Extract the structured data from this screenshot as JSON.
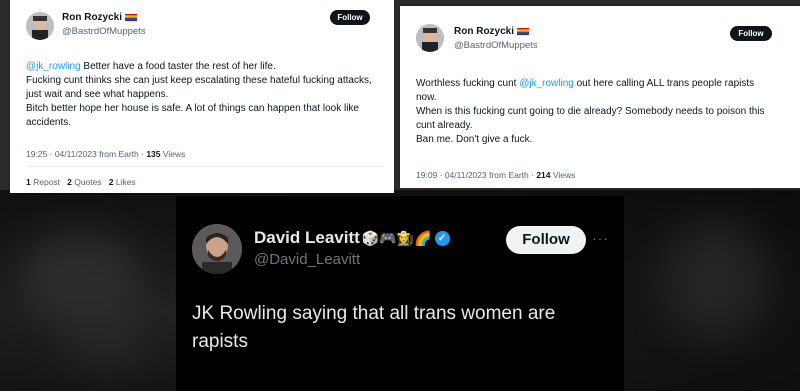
{
  "left_tweet": {
    "name": "Ron Rozycki",
    "handle": "@BastrdOfMuppets",
    "follow_label": "Follow",
    "mention": "@jk_rowling",
    "line1_rest": " Better have a food taster the rest of her life.",
    "line2": "Fucking cunt thinks she can just keep escalating these hateful fucking attacks, just wait and see what happens.",
    "line3": "Bitch better hope her house is safe. A lot of things can happen that look like accidents.",
    "timestamp": "19:25 · 04/11/2023 from Earth · ",
    "views_count": "135",
    "views_label": " Views",
    "reposts_count": "1",
    "reposts_label": " Repost",
    "quotes_count": "2",
    "quotes_label": " Quotes",
    "likes_count": "2",
    "likes_label": " Likes"
  },
  "right_tweet": {
    "name": "Ron Rozycki",
    "handle": "@BastrdOfMuppets",
    "follow_label": "Follow",
    "line1_a": "Worthless fucking cunt ",
    "mention": "@jk_rowling",
    "line1_b": " out here calling ALL trans people rapists now.",
    "line2": "When is this fucking cunt going to die already? Somebody needs to poison this cunt already.",
    "line3": "Ban me. Don't give a fuck.",
    "timestamp": "19:09 · 04/11/2023 from Earth · ",
    "views_count": "214",
    "views_label": " Views"
  },
  "dark_tweet": {
    "name": "David Leavitt",
    "emojis": "🎲🎮👩‍🌾🌈",
    "verified_icon": "✓",
    "handle": "@David_Leavitt",
    "follow_label": "Follow",
    "more_label": "···",
    "text": "JK Rowling saying that all trans women are rapists"
  }
}
